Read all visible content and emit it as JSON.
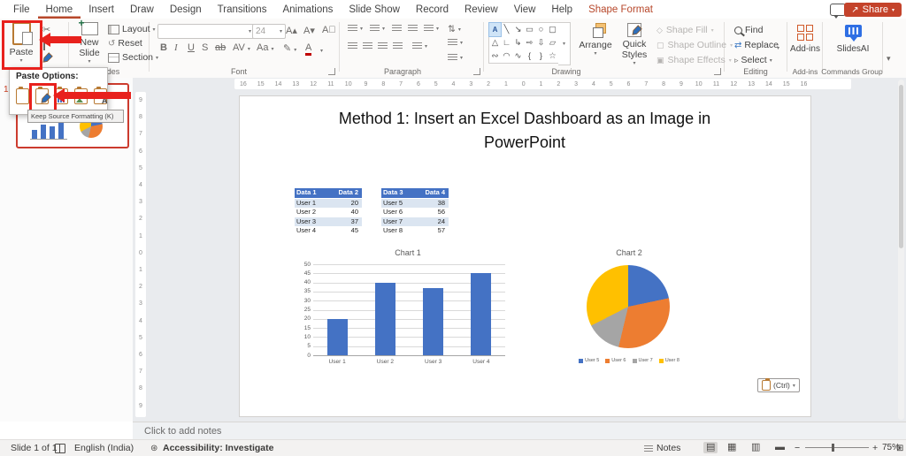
{
  "menu": {
    "tabs": [
      {
        "label": "File"
      },
      {
        "label": "Home",
        "active": true
      },
      {
        "label": "Insert"
      },
      {
        "label": "Draw"
      },
      {
        "label": "Design"
      },
      {
        "label": "Transitions"
      },
      {
        "label": "Animations"
      },
      {
        "label": "Slide Show"
      },
      {
        "label": "Record"
      },
      {
        "label": "Review"
      },
      {
        "label": "View"
      },
      {
        "label": "Help"
      },
      {
        "label": "Shape Format",
        "contextual": true
      }
    ],
    "share_label": "Share"
  },
  "ribbon": {
    "clipboard_group": {
      "paste": "Paste"
    },
    "slides_group": {
      "label": "Slides",
      "new_slide": "New Slide",
      "layout": "Layout",
      "reset": "Reset",
      "section": "Section"
    },
    "font_group": {
      "label": "Font",
      "size": "24",
      "buttons": [
        "B",
        "I",
        "U",
        "S",
        "ab",
        "AV",
        "Aa"
      ]
    },
    "paragraph_group": {
      "label": "Paragraph"
    },
    "drawing_group": {
      "label": "Drawing",
      "arrange": "Arrange",
      "quick_styles": "Quick Styles",
      "shape_fill": "Shape Fill",
      "shape_outline": "Shape Outline",
      "shape_effects": "Shape Effects",
      "shapes": [
        "text-box",
        "line",
        "arrow",
        "rectangle",
        "oval",
        "rounded-rectangle",
        "triangle",
        "elbow-connector",
        "elbow-arrow",
        "right-arrow",
        "down-arrow",
        "snip-rectangle",
        "scribble",
        "arc",
        "curve",
        "left-brace",
        "right-brace",
        "star"
      ]
    },
    "editing_group": {
      "label": "Editing",
      "find": "Find",
      "replace": "Replace",
      "select": "Select"
    },
    "addins_group": {
      "label": "Add-ins",
      "button": "Add-ins"
    },
    "commands_group": {
      "label": "Commands Group",
      "button": "SlidesAI"
    }
  },
  "paste_popup": {
    "title": "Paste Options:",
    "options": [
      "use-destination-theme",
      "keep-source-formatting",
      "embed",
      "picture",
      "keep-text-only"
    ],
    "tooltip": "Keep Source Formatting (K)"
  },
  "thumbnail_panel": {
    "slide_number": "1"
  },
  "rulers": {
    "horizontal": [
      16,
      15,
      14,
      13,
      12,
      11,
      10,
      9,
      8,
      7,
      6,
      5,
      4,
      3,
      2,
      1,
      0,
      1,
      2,
      3,
      4,
      5,
      6,
      7,
      8,
      9,
      10,
      11,
      12,
      13,
      14,
      15,
      16
    ],
    "vertical": [
      9,
      8,
      7,
      6,
      5,
      4,
      3,
      2,
      1,
      0,
      1,
      2,
      3,
      4,
      5,
      6,
      7,
      8,
      9
    ]
  },
  "slide": {
    "title": "Method 1: Insert an Excel Dashboard as an Image in PowerPoint",
    "paste_tag": "(Ctrl)"
  },
  "chart_data": [
    {
      "type": "table",
      "columns": [
        "Data 1",
        "Data 2"
      ],
      "rows": [
        [
          "User 1",
          20
        ],
        [
          "User 2",
          40
        ],
        [
          "User 3",
          37
        ],
        [
          "User 4",
          45
        ]
      ],
      "header_color": "#4472C4",
      "band_color": "#dbe5f1"
    },
    {
      "type": "table",
      "columns": [
        "Data 3",
        "Data 4"
      ],
      "rows": [
        [
          "User 5",
          38
        ],
        [
          "User 6",
          56
        ],
        [
          "User 7",
          24
        ],
        [
          "User 8",
          57
        ]
      ],
      "header_color": "#4472C4",
      "band_color": "#dbe5f1"
    },
    {
      "type": "bar",
      "title": "Chart 1",
      "categories": [
        "User 1",
        "User 2",
        "User 3",
        "User 4"
      ],
      "values": [
        20,
        40,
        37,
        45
      ],
      "ylim": [
        0,
        50
      ],
      "ytick_step": 5,
      "bar_color": "#4472C4",
      "grid": true,
      "legend": false
    },
    {
      "type": "pie",
      "title": "Chart 2",
      "labels": [
        "User 5",
        "User 6",
        "User 7",
        "User 8"
      ],
      "values": [
        38,
        56,
        24,
        57
      ],
      "colors": [
        "#4472C4",
        "#ED7D31",
        "#A5A5A5",
        "#FFC000"
      ],
      "legend_position": "bottom"
    }
  ],
  "notes": {
    "placeholder": "Click to add notes"
  },
  "status": {
    "slide_counter": "Slide 1 of 1",
    "language": "English (India)",
    "accessibility": "Accessibility: Investigate",
    "notes_label": "Notes",
    "zoom_level": "75%"
  },
  "colors": {
    "annotation_red": "#e8211d",
    "share_button": "#c4432b",
    "home_underline": "#b7472a",
    "contextual_tab": "#b7472a",
    "table_header": "#4472C4",
    "band_row": "#dbe5f1",
    "bar": "#4472C4",
    "pie": [
      "#4472C4",
      "#ED7D31",
      "#A5A5A5",
      "#FFC000"
    ],
    "thumbnail_border": "#cc3b2e"
  }
}
